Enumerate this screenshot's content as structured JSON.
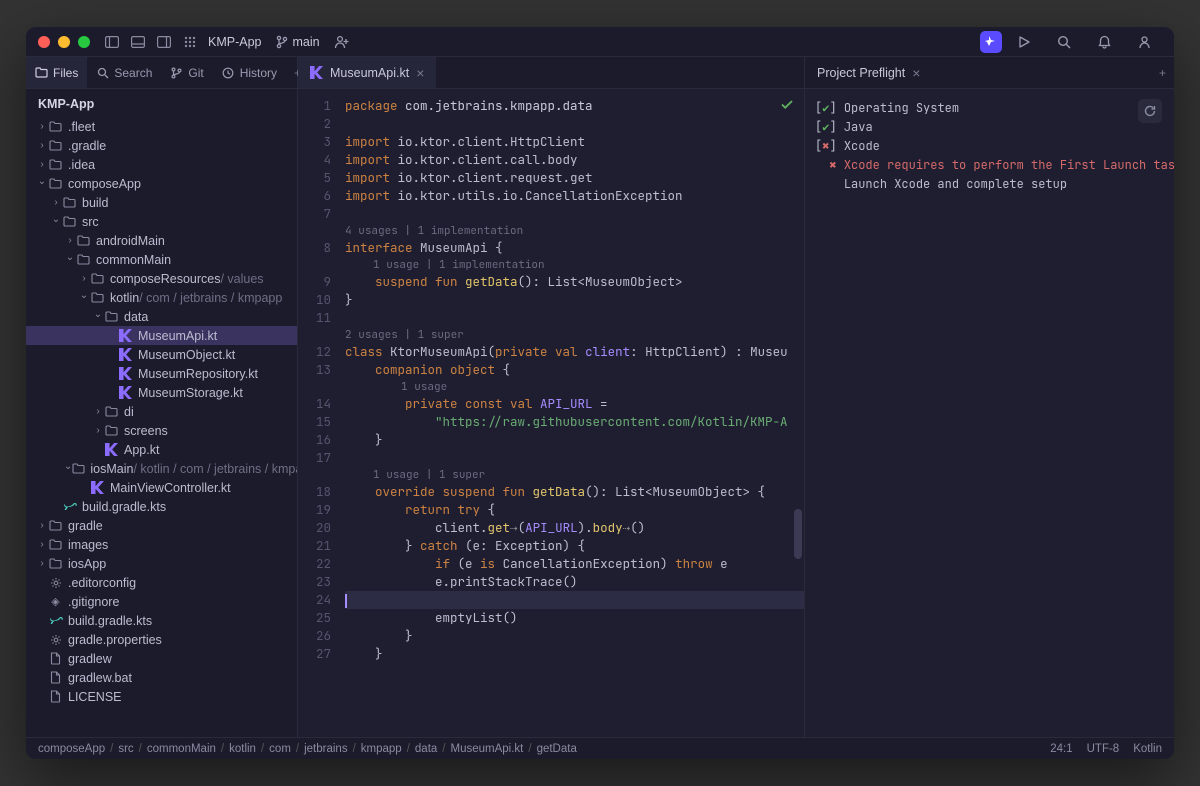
{
  "titlebar": {
    "project": "KMP-App",
    "branch": "main"
  },
  "leftTabs": {
    "files": "Files",
    "search": "Search",
    "git": "Git",
    "history": "History"
  },
  "editorTab": {
    "label": "MuseumApi.kt"
  },
  "rightTab": {
    "label": "Project Preflight"
  },
  "sidebar": {
    "project": "KMP-App",
    "nodes": [
      {
        "d": 0,
        "c": "right",
        "i": "folder",
        "t": ".fleet"
      },
      {
        "d": 0,
        "c": "right",
        "i": "folder",
        "t": ".gradle"
      },
      {
        "d": 0,
        "c": "right",
        "i": "folder",
        "t": ".idea"
      },
      {
        "d": 0,
        "c": "down",
        "i": "folder",
        "t": "composeApp"
      },
      {
        "d": 1,
        "c": "right",
        "i": "folder",
        "t": "build"
      },
      {
        "d": 1,
        "c": "down",
        "i": "folder",
        "t": "src"
      },
      {
        "d": 2,
        "c": "right",
        "i": "folder",
        "t": "androidMain"
      },
      {
        "d": 2,
        "c": "down",
        "i": "folder",
        "t": "commonMain"
      },
      {
        "d": 3,
        "c": "right",
        "i": "folder",
        "t": "composeResources",
        "suffix": " / values"
      },
      {
        "d": 3,
        "c": "down",
        "i": "folder",
        "t": "kotlin",
        "suffix": " / com / jetbrains / kmpapp"
      },
      {
        "d": 4,
        "c": "down",
        "i": "folder",
        "t": "data"
      },
      {
        "d": 5,
        "c": "",
        "i": "kotlin",
        "t": "MuseumApi.kt",
        "sel": true
      },
      {
        "d": 5,
        "c": "",
        "i": "kotlin",
        "t": "MuseumObject.kt"
      },
      {
        "d": 5,
        "c": "",
        "i": "kotlin",
        "t": "MuseumRepository.kt"
      },
      {
        "d": 5,
        "c": "",
        "i": "kotlin",
        "t": "MuseumStorage.kt"
      },
      {
        "d": 4,
        "c": "right",
        "i": "folder",
        "t": "di"
      },
      {
        "d": 4,
        "c": "right",
        "i": "folder",
        "t": "screens"
      },
      {
        "d": 4,
        "c": "",
        "i": "kotlin",
        "t": "App.kt"
      },
      {
        "d": 2,
        "c": "down",
        "i": "folder",
        "t": "iosMain",
        "suffix": " / kotlin / com / jetbrains / kmpapp"
      },
      {
        "d": 3,
        "c": "",
        "i": "kotlin",
        "t": "MainViewController.kt"
      },
      {
        "d": 1,
        "c": "",
        "i": "gradle",
        "t": "build.gradle.kts"
      },
      {
        "d": 0,
        "c": "right",
        "i": "folder",
        "t": "gradle"
      },
      {
        "d": 0,
        "c": "right",
        "i": "folder",
        "t": "images"
      },
      {
        "d": 0,
        "c": "right",
        "i": "folder",
        "t": "iosApp"
      },
      {
        "d": 0,
        "c": "",
        "i": "gear",
        "t": ".editorconfig"
      },
      {
        "d": 0,
        "c": "",
        "i": "git",
        "t": ".gitignore"
      },
      {
        "d": 0,
        "c": "",
        "i": "gradle",
        "t": "build.gradle.kts"
      },
      {
        "d": 0,
        "c": "",
        "i": "gear",
        "t": "gradle.properties"
      },
      {
        "d": 0,
        "c": "",
        "i": "txt",
        "t": "gradlew"
      },
      {
        "d": 0,
        "c": "",
        "i": "txt",
        "t": "gradlew.bat"
      },
      {
        "d": 0,
        "c": "",
        "i": "txt",
        "t": "LICENSE"
      }
    ]
  },
  "code": {
    "hint1": "4 usages | 1 implementation",
    "hint2": "1 usage | 1 implementation",
    "hint3": "2 usages | 1 super",
    "hint4": "1 usage",
    "hint5": "1 usage | 1 super",
    "l1": {
      "a": "package",
      "b": " com.jetbrains.kmpapp.data"
    },
    "l3": {
      "a": "import",
      "b": " io.ktor.client.HttpClient"
    },
    "l4": {
      "a": "import",
      "b": " io.ktor.client.call.body"
    },
    "l5": {
      "a": "import",
      "b": " io.ktor.client.request.get"
    },
    "l6": {
      "a": "import",
      "b": " io.ktor.utils.io.CancellationException"
    },
    "l8": {
      "a": "interface",
      "b": " MuseumApi {"
    },
    "l9": {
      "a": "    suspend fun ",
      "b": "getData",
      "c": "(): List<MuseumObject>"
    },
    "l10": "}",
    "l12": {
      "a": "class",
      "b": " KtorMuseumApi(",
      "c": "private val ",
      "d": "client",
      "e": ": HttpClient) : Museu"
    },
    "l13": {
      "a": "    companion object",
      "b": " {"
    },
    "l14": {
      "a": "        private const val ",
      "b": "API_URL",
      "c": " ="
    },
    "l15": {
      "a": "            ",
      "b": "\"https://raw.githubusercontent.com/Kotlin/KMP-A"
    },
    "l16": "    }",
    "l18": {
      "a": "    override suspend fun ",
      "b": "getData",
      "c": "(): List<MuseumObject> {"
    },
    "l19": {
      "a": "        return try",
      "b": " {"
    },
    "l20": {
      "a": "            client.",
      "b": "get",
      "c": "(",
      "d": "API_URL",
      "e": ").",
      "f": "body",
      "g": "()"
    },
    "l21": {
      "a": "        } ",
      "b": "catch",
      "c": " (e: Exception) {"
    },
    "l22": {
      "a": "            if",
      "b": " (e ",
      "c": "is",
      "d": " CancellationException) ",
      "e": "throw",
      "f": " e"
    },
    "l23": "            e.printStackTrace()",
    "l25": "            emptyList()",
    "l26": "        }",
    "l27": "    }"
  },
  "preflight": {
    "os": "Operating System",
    "java": "Java",
    "xcode": "Xcode",
    "err1": "Xcode requires to perform the First Launch tasks",
    "err2": "Launch Xcode and complete setup"
  },
  "breadcrumbs": [
    "composeApp",
    "src",
    "commonMain",
    "kotlin",
    "com",
    "jetbrains",
    "kmpapp",
    "data",
    "MuseumApi.kt",
    "getData"
  ],
  "status": {
    "pos": "24:1",
    "enc": "UTF-8",
    "lang": "Kotlin"
  }
}
